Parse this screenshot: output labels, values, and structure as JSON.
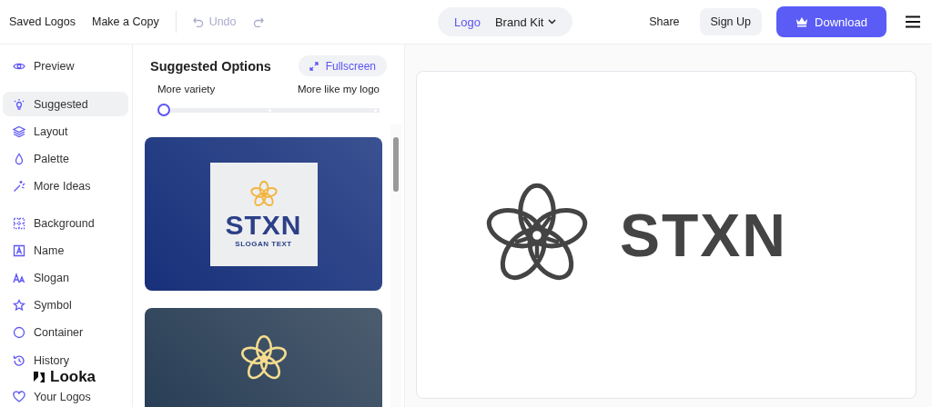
{
  "header": {
    "links": [
      "Saved Logos",
      "Make a Copy"
    ],
    "undo": {
      "label": "Undo",
      "disabled": true
    },
    "redo": {
      "disabled": true
    },
    "mode_tabs": [
      {
        "label": "Logo",
        "selected": true,
        "dropdown": false
      },
      {
        "label": "Brand Kit",
        "selected": false,
        "dropdown": true
      }
    ],
    "share": "Share",
    "sign_up": "Sign Up",
    "download": "Download"
  },
  "sidebar": {
    "groups": [
      {
        "items": [
          {
            "label": "Preview",
            "selected": false
          }
        ]
      },
      {
        "items": [
          {
            "label": "Suggested",
            "selected": true
          },
          {
            "label": "Layout",
            "selected": false
          },
          {
            "label": "Palette",
            "selected": false
          },
          {
            "label": "More Ideas",
            "selected": false
          }
        ]
      },
      {
        "items": [
          {
            "label": "Background",
            "selected": false
          },
          {
            "label": "Name",
            "selected": false
          },
          {
            "label": "Slogan",
            "selected": false
          },
          {
            "label": "Symbol",
            "selected": false
          },
          {
            "label": "Container",
            "selected": false
          }
        ]
      },
      {
        "items": [
          {
            "label": "History",
            "selected": false
          },
          {
            "label": "Your Logos",
            "selected": false
          }
        ]
      }
    ],
    "brand": "Looka"
  },
  "suggestions": {
    "title": "Suggested Options",
    "fullscreen": "Fullscreen",
    "slider": {
      "left_label": "More variety",
      "right_label": "More like my logo",
      "level": 0
    },
    "cards": [
      {
        "kind": "framed",
        "name": "STXN",
        "slogan": "SLOGAN TEXT"
      },
      {
        "kind": "plain"
      }
    ]
  },
  "preview": {
    "name": "STXN"
  }
}
